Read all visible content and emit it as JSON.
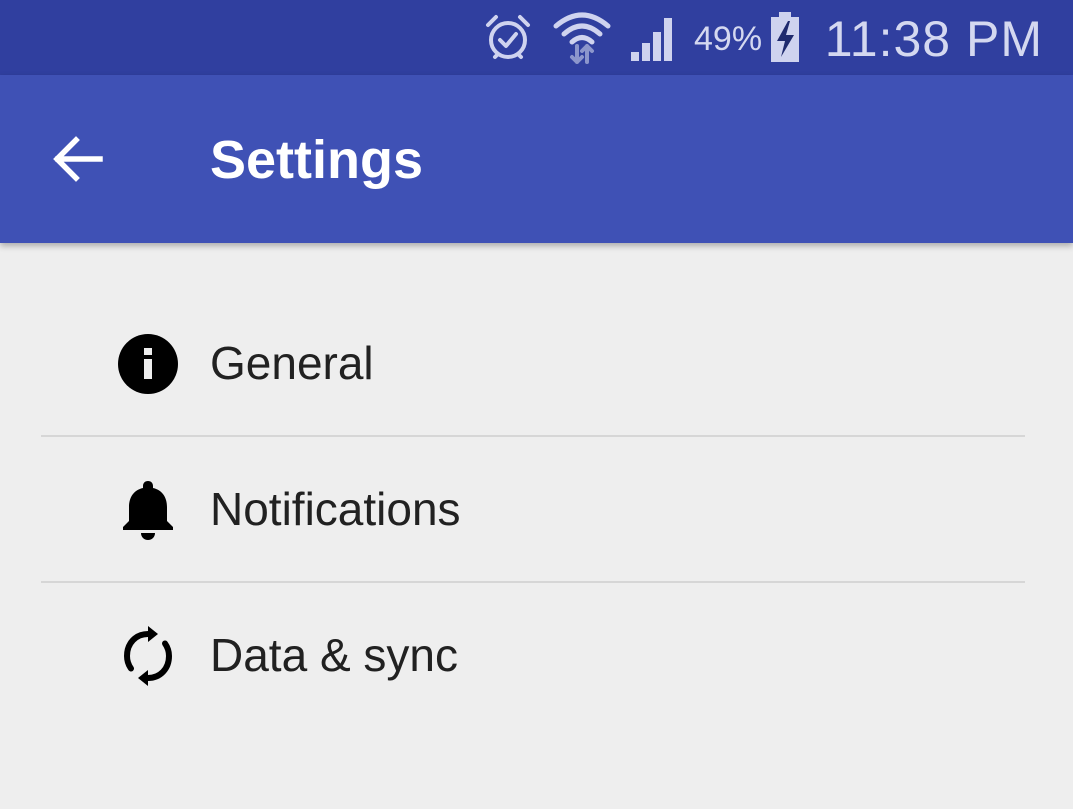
{
  "status_bar": {
    "icons": [
      "alarm-icon",
      "wifi-icon",
      "cell-signal-icon",
      "battery-charging-icon"
    ],
    "battery_percent": "49%",
    "time": "11:38 PM",
    "background_color": "#303f9f"
  },
  "app_bar": {
    "back_icon": "arrow-back-icon",
    "title": "Settings",
    "background_color": "#3f51b5"
  },
  "settings": {
    "items": [
      {
        "icon": "info-icon",
        "label": "General"
      },
      {
        "icon": "bell-icon",
        "label": "Notifications"
      },
      {
        "icon": "sync-icon",
        "label": "Data & sync"
      }
    ]
  }
}
